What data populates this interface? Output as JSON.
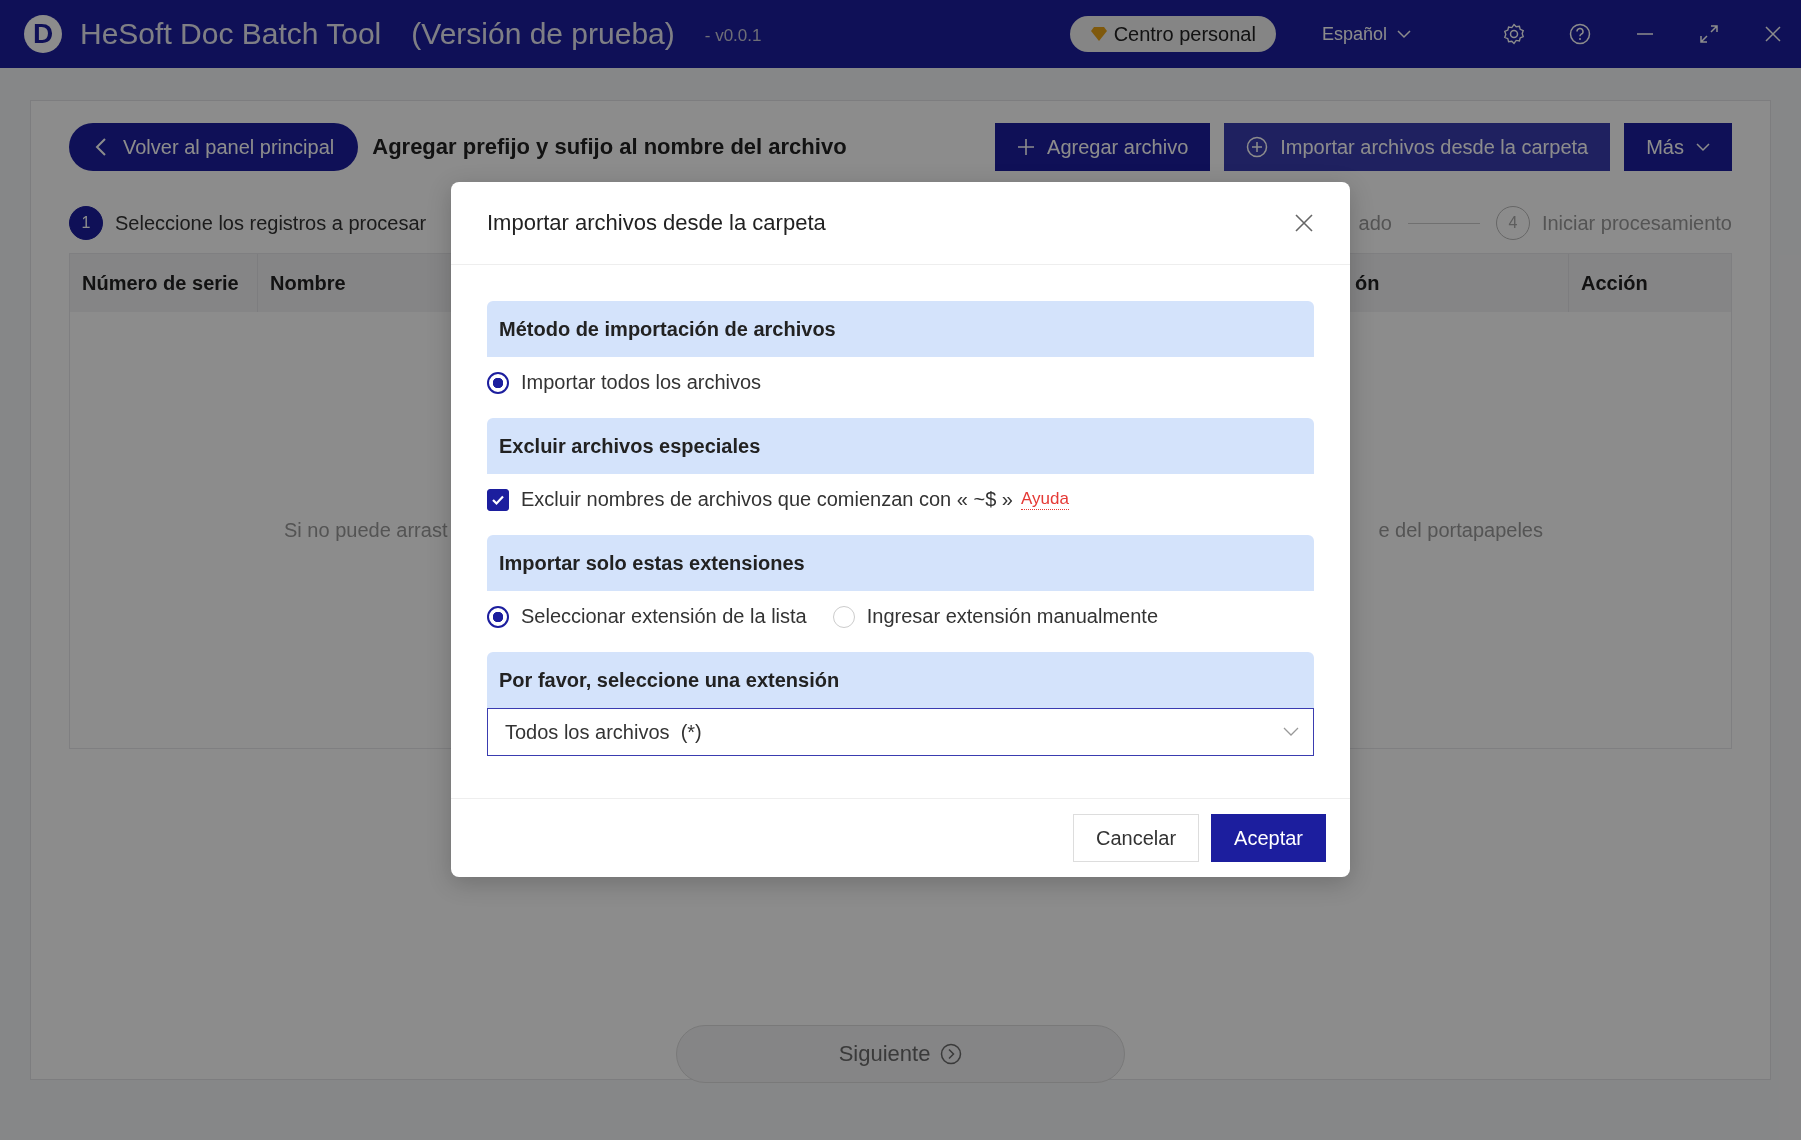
{
  "title_bar": {
    "logo_letter": "D",
    "app_name": "HeSoft Doc Batch Tool",
    "edition": "(Versión de prueba)",
    "version": "- v0.0.1",
    "account_button": "Centro personal",
    "language": "Español"
  },
  "toolbar": {
    "back_button": "Volver al panel principal",
    "page_title": "Agregar prefijo y sufijo al nombre del archivo",
    "buttons": [
      {
        "kind": "add",
        "label": "Agregar archivo"
      },
      {
        "kind": "folder",
        "label": "Importar archivos desde la carpeta"
      },
      {
        "kind": "more",
        "label": "Más"
      }
    ]
  },
  "steps": [
    {
      "number": "1",
      "label": "Seleccione los registros a procesar",
      "active": true
    },
    {
      "label": "ado",
      "active": false
    },
    {
      "number": "4",
      "label": "Iniciar procesamiento",
      "active": false
    }
  ],
  "table": {
    "columns": [
      "Número de serie",
      "Nombre",
      "ón",
      "Acción"
    ],
    "empty_text_left": "Si no puede arrast",
    "empty_text_right": "e del portapapeles"
  },
  "next_button": {
    "label": "Siguiente",
    "disabled": true
  },
  "dialog": {
    "title": "Importar archivos desde la carpeta",
    "sections": [
      {
        "heading": "Método de importación de archivos",
        "options": [
          {
            "kind": "radio",
            "label": "Importar todos los archivos",
            "selected": true
          }
        ]
      },
      {
        "heading": "Excluir archivos especiales",
        "options": [
          {
            "kind": "checkbox",
            "label": "Excluir nombres de archivos que comienzan con « ~$ »",
            "checked": true,
            "link": "Ayuda"
          }
        ]
      },
      {
        "heading": "Importar solo estas extensiones",
        "options": [
          {
            "kind": "radio",
            "label": "Seleccionar extensión de la lista",
            "selected": true
          },
          {
            "kind": "radio",
            "label": "Ingresar extensión manualmente",
            "selected": false
          }
        ]
      },
      {
        "heading": "Por favor, seleccione una extensión",
        "select": {
          "value": "Todos los archivos  (*)"
        }
      }
    ],
    "buttons": [
      {
        "label": "Cancelar",
        "primary": false
      },
      {
        "label": "Aceptar",
        "primary": true
      }
    ]
  }
}
